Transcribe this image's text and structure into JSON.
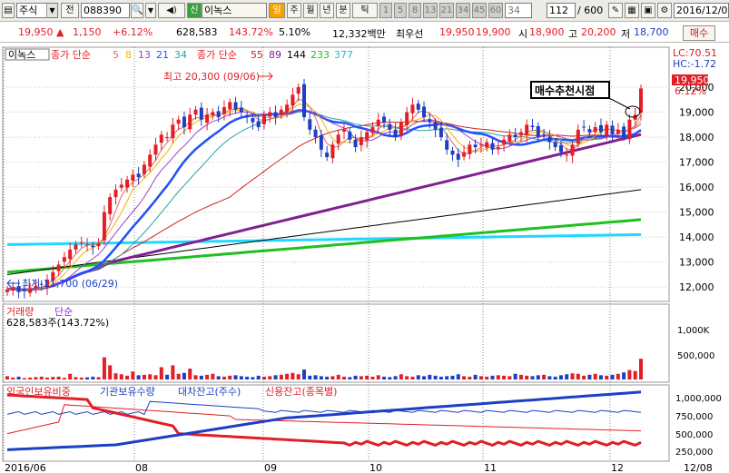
{
  "toolbar": {
    "market": "주식",
    "jeon": "전",
    "code": "088390",
    "sin": "신",
    "name": "이녹스",
    "il": "일",
    "periods": [
      "주",
      "월",
      "년",
      "분",
      "틱"
    ],
    "minutes": [
      "1",
      "5",
      "8",
      "13",
      "21",
      "34",
      "45",
      "60",
      "34"
    ],
    "count": "112",
    "total": "/ 600",
    "date": "2016/12/0"
  },
  "quote": {
    "price": "19,950",
    "arrow": "▲",
    "change": "1,150",
    "pct": "+6.12%",
    "volume": "628,583",
    "vol_ratio": "143.72%",
    "turnover": "5.10%",
    "amount": "12,332백만",
    "choi_label": "최우선",
    "ask": "19,950",
    "bid": "19,900",
    "open_label": "시",
    "open": "18,900",
    "high_label": "고",
    "high": "20,200",
    "low_label": "저",
    "low": "18,700",
    "buy_label": "매수"
  },
  "legend": {
    "name": "이녹스",
    "ma_label": "종가 단순",
    "ma_short": [
      "5",
      "8",
      "13",
      "21",
      "34"
    ],
    "ma_label2": "종가 단순",
    "ma_long": [
      "55",
      "89",
      "144",
      "233",
      "377"
    ],
    "colors_short": [
      "#e06666",
      "#f0b400",
      "#a040c0",
      "#2050ff",
      "#2aa0a0"
    ],
    "colors_long": [
      "#d02020",
      "#802090",
      "#000000",
      "#20c020",
      "#20d8ff"
    ]
  },
  "annotations": {
    "high_label": "최고 20,300 (09/06)",
    "low_label": "최저 11,700 (06/29)",
    "signal": "매수추천시점",
    "lc": "LC:70.51",
    "hc": "HC:-1.72",
    "price_tag": "19,950",
    "pct_tag": "6.12%"
  },
  "volume_panel": {
    "title": "거래량",
    "mode": "단순",
    "value": "628,583주(143.72%)",
    "ticks": [
      "1,000K",
      "500,000"
    ]
  },
  "holding_panel": {
    "s1": "외국인보유비중",
    "s2": "기관보유수량",
    "s3": "대차잔고(주수)",
    "s4": "신용잔고(종목별)",
    "ticks": [
      "1,000,000",
      "750,000",
      "500,000",
      "250,000"
    ]
  },
  "xaxis": [
    "2016/06",
    "08",
    "09",
    "10",
    "11",
    "12",
    "12/08"
  ],
  "chart_data": {
    "type": "candlestick",
    "price_axis": [
      "20,000",
      "19,000",
      "18,000",
      "17,000",
      "16,000",
      "15,000",
      "14,000",
      "13,000",
      "12,000"
    ],
    "ylim": [
      11500,
      20800
    ],
    "closes": [
      11900,
      12000,
      11800,
      11850,
      11950,
      12050,
      12100,
      12300,
      12600,
      12900,
      13200,
      13500,
      13700,
      13800,
      13700,
      13600,
      13750,
      15000,
      15600,
      15900,
      16100,
      16300,
      16500,
      16400,
      16900,
      17300,
      17700,
      18100,
      18000,
      18500,
      18700,
      18400,
      18900,
      19100,
      18700,
      18900,
      19000,
      18800,
      19200,
      19400,
      19100,
      19000,
      18800,
      18600,
      18400,
      18900,
      19000,
      18800,
      19100,
      19300,
      19700,
      20000,
      18800,
      18300,
      18000,
      17500,
      17200,
      17700,
      18100,
      18300,
      17900,
      17600,
      18000,
      18200,
      18400,
      18700,
      18600,
      18300,
      18000,
      18600,
      19000,
      19300,
      19100,
      18800,
      18600,
      18300,
      18000,
      17500,
      17300,
      17100,
      17400,
      17700,
      17600,
      17700,
      17800,
      17500,
      17600,
      17900,
      18100,
      18000,
      18200,
      18500,
      18400,
      18000,
      18100,
      17800,
      17600,
      17400,
      17300,
      17700,
      18300,
      18400,
      18200,
      18400,
      18200,
      18500,
      18100,
      18300,
      18000,
      18700,
      18900,
      19950
    ],
    "volumes": [
      70,
      40,
      60,
      30,
      40,
      50,
      60,
      40,
      55,
      60,
      35,
      120,
      50,
      40,
      45,
      60,
      50,
      470,
      300,
      130,
      110,
      80,
      170,
      90,
      100,
      110,
      90,
      260,
      100,
      300,
      120,
      140,
      230,
      90,
      80,
      100,
      120,
      70,
      60,
      80,
      90,
      70,
      60,
      50,
      80,
      60,
      70,
      90,
      100,
      120,
      140,
      110,
      210,
      80,
      90,
      70,
      60,
      70,
      100,
      60,
      50,
      80,
      70,
      80,
      60,
      90,
      60,
      50,
      70,
      110,
      70,
      60,
      90,
      70,
      100,
      80,
      60,
      70,
      80,
      110,
      70,
      60,
      100,
      70,
      60,
      80,
      90,
      80,
      70,
      120,
      100,
      80,
      70,
      90,
      100,
      70,
      60,
      90,
      110,
      130,
      120,
      80,
      100,
      120,
      90,
      80,
      100,
      120,
      150,
      200,
      180,
      440
    ],
    "vol_ylim": [
      0,
      1500
    ]
  },
  "colors": {
    "up": "#e21e26",
    "down": "#1c3fc4",
    "bg": "#ffffff",
    "grid": "#c8c8c8"
  }
}
